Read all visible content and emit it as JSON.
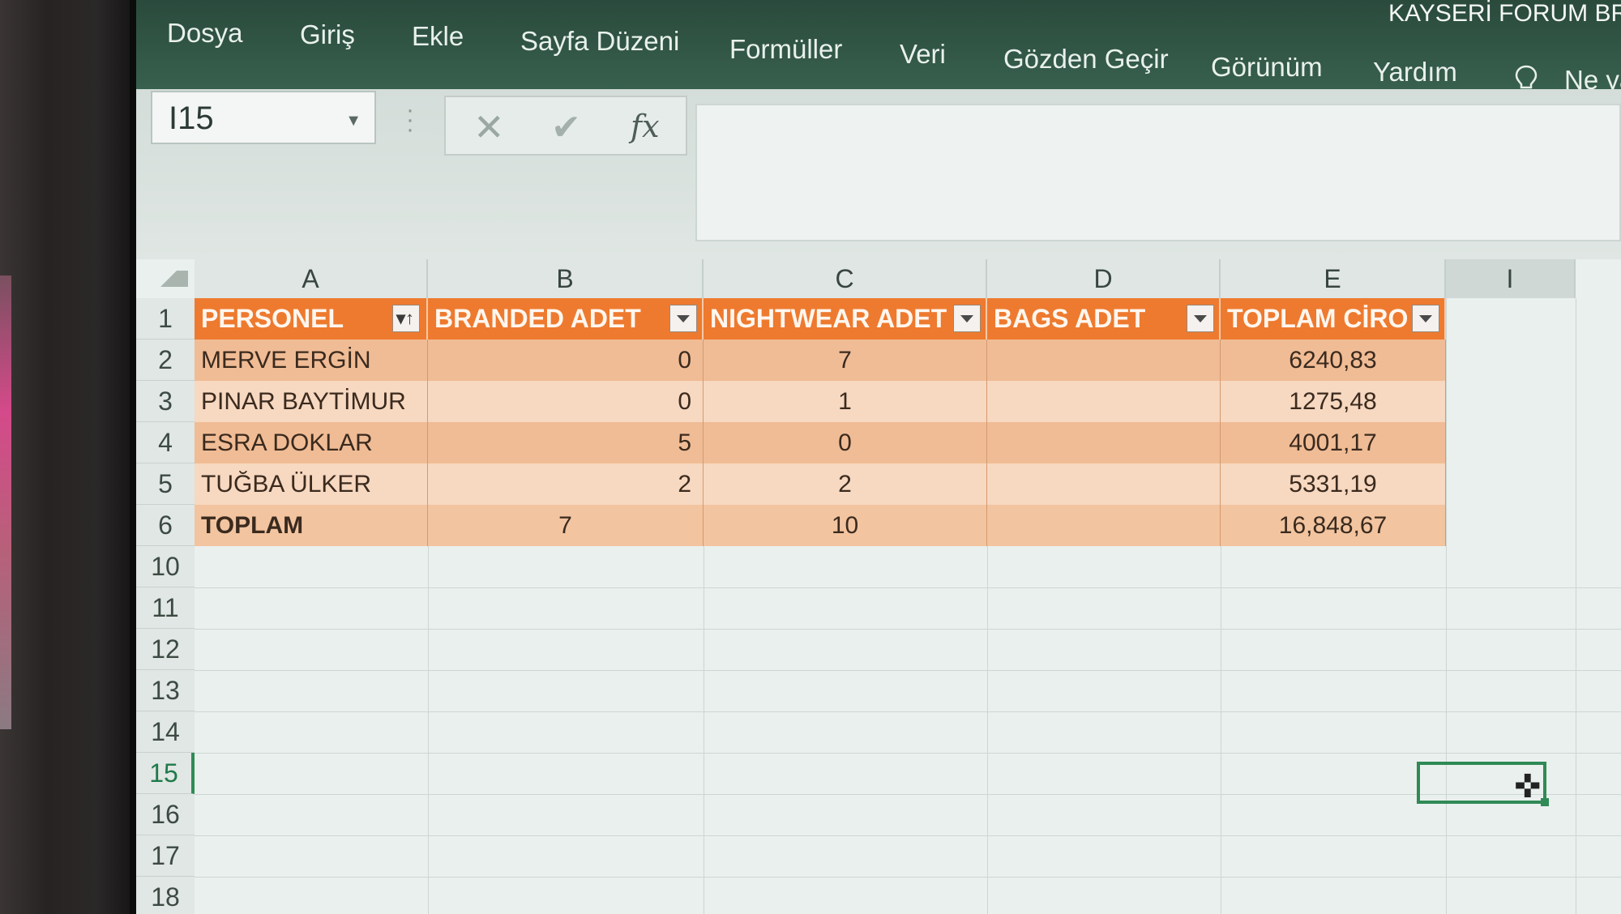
{
  "app": {
    "title": "KAYSERİ FORUM BRA"
  },
  "ribbon": {
    "tabs": [
      "Dosya",
      "Giriş",
      "Ekle",
      "Sayfa Düzeni",
      "Formüller",
      "Veri",
      "Gözden Geçir",
      "Görünüm",
      "Yardım"
    ],
    "tell_me": "Ne ya"
  },
  "formula_bar": {
    "name_box": "I15",
    "cancel_symbol": "✕",
    "enter_symbol": "✔",
    "fx_symbol": "fx",
    "content": ""
  },
  "sheet": {
    "columns": [
      "A",
      "B",
      "C",
      "D",
      "E",
      "I"
    ],
    "headers": [
      "PERSONEL",
      "BRANDED ADET",
      "NIGHTWEAR ADET",
      "BAGS ADET",
      "TOPLAM CİRO"
    ],
    "rows": [
      {
        "num": "2",
        "name": "MERVE ERGİN",
        "branded": "0",
        "nightwear": "7",
        "bags": "",
        "ciro": "6240,83"
      },
      {
        "num": "3",
        "name": "PINAR BAYTİMUR",
        "branded": "0",
        "nightwear": "1",
        "bags": "",
        "ciro": "1275,48"
      },
      {
        "num": "4",
        "name": "ESRA DOKLAR",
        "branded": "5",
        "nightwear": "0",
        "bags": "",
        "ciro": "4001,17"
      },
      {
        "num": "5",
        "name": "TUĞBA ÜLKER",
        "branded": "2",
        "nightwear": "2",
        "bags": "",
        "ciro": "5331,19"
      }
    ],
    "total": {
      "num": "6",
      "name": "TOPLAM",
      "branded": "7",
      "nightwear": "10",
      "bags": "",
      "ciro": "16,848,67"
    },
    "header_row_num": "1",
    "empty_rows": [
      "10",
      "11",
      "12",
      "13",
      "14",
      "15",
      "16",
      "17",
      "18"
    ],
    "active_cell": "I15"
  },
  "colors": {
    "table_header": "#ee7a2f",
    "band_dark": "#f0bc95",
    "band_light": "#f7d8c0",
    "selection": "#2f8a55"
  }
}
